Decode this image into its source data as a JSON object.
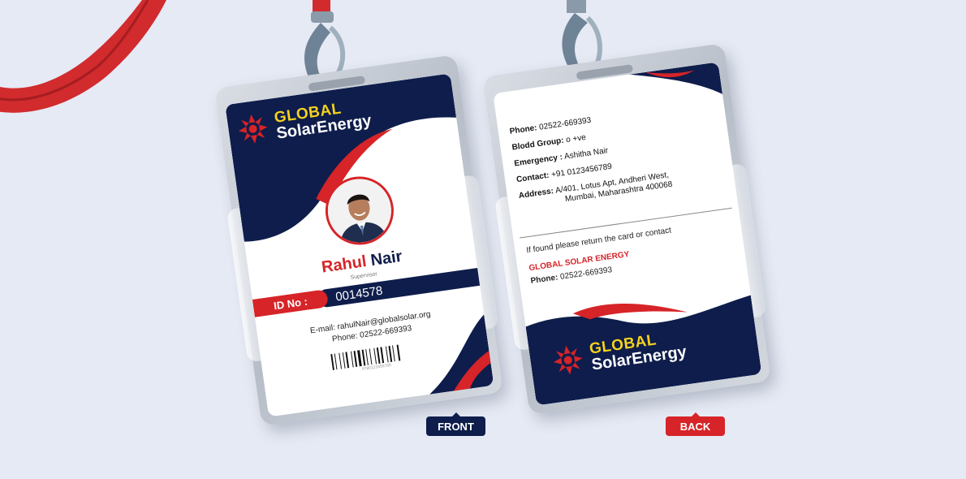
{
  "colors": {
    "navy": "#0e1d4b",
    "red": "#d62428",
    "yellow": "#f4d21e",
    "background": "#e6eaf4"
  },
  "brand": {
    "line1": "GLOBAL",
    "line2": "SolarEnergy",
    "icon": "sun-logo-icon"
  },
  "front": {
    "first_name": "Rahul",
    "last_name": "Nair",
    "role": "Supervisor",
    "id_label": "ID No :",
    "id_number": "0014578",
    "email": "E-mail: rahulNair@globalsolar.org",
    "phone": "Phone: 02522-669393",
    "barcode_number": "9780123456789",
    "tag": "FRONT"
  },
  "back": {
    "phone_label": "Phone:",
    "phone_value": "02522-669393",
    "blood_label": "Blodd Group:",
    "blood_value": "o +ve",
    "emergency_label": "Emergency :",
    "emergency_value": "Ashitha Nair",
    "contact_label": "Contact:",
    "contact_value": "+91 0123456789",
    "address_label": "Address:",
    "address_line1": "A/401, Lotus Apt, Andheri West,",
    "address_line2": "Mumbai, Maharashtra 400068",
    "found_text": "If found please return the card or contact",
    "company": "GLOBAL SOLAR ENERGY",
    "company_phone_label": "Phone:",
    "company_phone_value": "02522-669393",
    "tag": "BACK"
  }
}
